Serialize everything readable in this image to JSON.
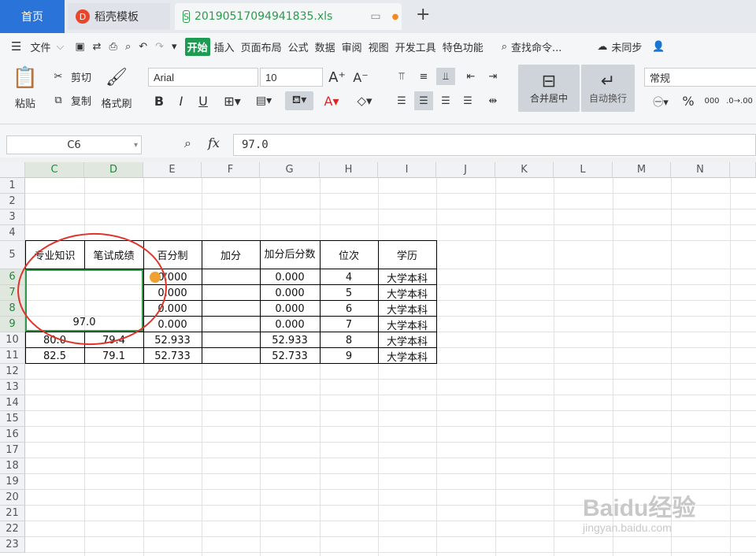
{
  "tabs": {
    "home": "首页",
    "template": "稻壳模板",
    "file": "20190517094941835.xls",
    "new_tab": "+"
  },
  "menu": [
    "文件",
    "开始",
    "插入",
    "页面布局",
    "公式",
    "数据",
    "审阅",
    "视图",
    "开发工具",
    "特色功能"
  ],
  "menu_search": "查找命令...",
  "menu_sync": "未同步",
  "ribbon": {
    "paste": "粘贴",
    "cut": "剪切",
    "copy": "复制",
    "format_painter": "格式刷",
    "font_name": "Arial",
    "font_size": "10",
    "merge": "合并居中",
    "wrap": "自动换行",
    "number_format": "常规"
  },
  "formula": {
    "cell_ref": "C6",
    "fx": "fx",
    "value": "97.0"
  },
  "columns": [
    "C",
    "D",
    "E",
    "F",
    "G",
    "H",
    "I",
    "J",
    "K",
    "L",
    "M",
    "N"
  ],
  "rows": [
    "1",
    "2",
    "3",
    "4",
    "5",
    "6",
    "7",
    "8",
    "9",
    "10",
    "11",
    "12",
    "13",
    "14",
    "15",
    "16",
    "17",
    "18",
    "19",
    "20",
    "21",
    "22",
    "23"
  ],
  "table": {
    "headers": [
      "专业知识",
      "笔试成绩",
      "百分制",
      "加分",
      "加分后分数",
      "位次",
      "学历"
    ],
    "merged_value": "97.0",
    "rows": [
      {
        "c": "",
        "d": "",
        "e": "0.000",
        "g": "0.000",
        "h": "4",
        "i": "大学本科"
      },
      {
        "c": "",
        "d": "",
        "e": "0.000",
        "g": "0.000",
        "h": "5",
        "i": "大学本科"
      },
      {
        "c": "",
        "d": "",
        "e": "0.000",
        "g": "0.000",
        "h": "6",
        "i": "大学本科"
      },
      {
        "c": "",
        "d": "",
        "e": "0.000",
        "g": "0.000",
        "h": "7",
        "i": "大学本科"
      },
      {
        "c": "80.0",
        "d": "79.4",
        "e": "52.933",
        "g": "52.933",
        "h": "8",
        "i": "大学本科"
      },
      {
        "c": "82.5",
        "d": "79.1",
        "e": "52.733",
        "g": "52.733",
        "h": "9",
        "i": "大学本科"
      }
    ]
  },
  "watermark": {
    "brand": "Baidu经验",
    "url": "jingyan.baidu.com"
  }
}
